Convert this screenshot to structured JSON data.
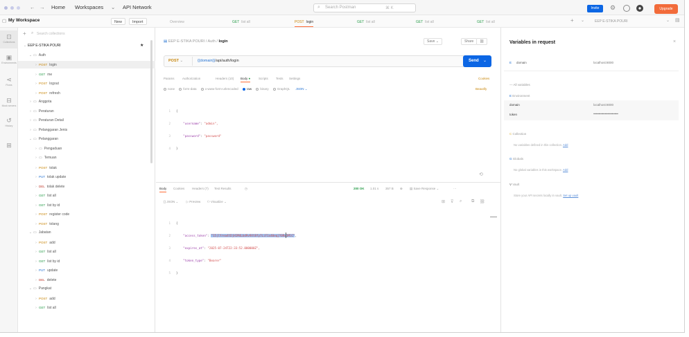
{
  "titlebar": {
    "nav": [
      "Home",
      "Workspaces",
      "API Network"
    ],
    "search_placeholder": "Search Postman",
    "search_shortcut": "⌘ K",
    "invite_label": "Invite",
    "upgrade_label": "Upgrade"
  },
  "workspace": {
    "name": "My Workspace",
    "new_label": "New",
    "import_label": "Import"
  },
  "tabs": [
    {
      "method": "",
      "label": "Overview"
    },
    {
      "method": "GET",
      "label": "list all"
    },
    {
      "method": "POST",
      "label": "login"
    },
    {
      "method": "GET",
      "label": "list all"
    },
    {
      "method": "GET",
      "label": "list all"
    },
    {
      "method": "GET",
      "label": "list all"
    }
  ],
  "env_selector": "EEP E-STIKA POURI",
  "leftnav": [
    {
      "icon": "collections-icon",
      "label": "Collections"
    },
    {
      "icon": "environments-icon",
      "label": "Environments"
    },
    {
      "icon": "flows-icon",
      "label": "Flows"
    },
    {
      "icon": "mock-servers-icon",
      "label": "Mock servers"
    },
    {
      "icon": "history-icon",
      "label": "History"
    },
    {
      "icon": "apps-icon",
      "label": ""
    }
  ],
  "sidebar": {
    "search_placeholder": "Search collections",
    "items": [
      {
        "depth": 0,
        "kind": "collection",
        "method": "",
        "label": "EEP E-STIKA POURI"
      },
      {
        "depth": 1,
        "kind": "folder",
        "method": "",
        "label": "Auth"
      },
      {
        "depth": 2,
        "kind": "request",
        "method": "POST",
        "label": "login"
      },
      {
        "depth": 2,
        "kind": "request",
        "method": "GET",
        "label": "me"
      },
      {
        "depth": 2,
        "kind": "request",
        "method": "POST",
        "label": "logout"
      },
      {
        "depth": 2,
        "kind": "request",
        "method": "POST",
        "label": "refresh"
      },
      {
        "depth": 1,
        "kind": "folder",
        "method": "",
        "label": "Anggota"
      },
      {
        "depth": 1,
        "kind": "folder",
        "method": "",
        "label": "Peraturan"
      },
      {
        "depth": 1,
        "kind": "folder",
        "method": "",
        "label": "Peraturan Detail"
      },
      {
        "depth": 1,
        "kind": "folder",
        "method": "",
        "label": "Pelanggaran Jenis"
      },
      {
        "depth": 1,
        "kind": "folder",
        "method": "",
        "label": "Pelanggaran"
      },
      {
        "depth": 2,
        "kind": "folder",
        "method": "",
        "label": "Pengaduan"
      },
      {
        "depth": 2,
        "kind": "folder",
        "method": "",
        "label": "Temuan"
      },
      {
        "depth": 2,
        "kind": "request",
        "method": "POST",
        "label": "tolak"
      },
      {
        "depth": 2,
        "kind": "request",
        "method": "PUT",
        "label": "tolak update"
      },
      {
        "depth": 2,
        "kind": "request",
        "method": "DEL",
        "label": "tolak delete"
      },
      {
        "depth": 2,
        "kind": "request",
        "method": "GET",
        "label": "list all"
      },
      {
        "depth": 2,
        "kind": "request",
        "method": "GET",
        "label": "list by id"
      },
      {
        "depth": 2,
        "kind": "request",
        "method": "POST",
        "label": "register code"
      },
      {
        "depth": 2,
        "kind": "request",
        "method": "POST",
        "label": "tolang"
      },
      {
        "depth": 1,
        "kind": "folder",
        "method": "",
        "label": "Jabatan"
      },
      {
        "depth": 2,
        "kind": "request",
        "method": "POST",
        "label": "add"
      },
      {
        "depth": 2,
        "kind": "request",
        "method": "GET",
        "label": "list all"
      },
      {
        "depth": 2,
        "kind": "request",
        "method": "GET",
        "label": "list by id"
      },
      {
        "depth": 2,
        "kind": "request",
        "method": "PUT",
        "label": "update"
      },
      {
        "depth": 2,
        "kind": "request",
        "method": "DEL",
        "label": "delete"
      },
      {
        "depth": 1,
        "kind": "folder",
        "method": "",
        "label": "Pangkat"
      },
      {
        "depth": 2,
        "kind": "request",
        "method": "POST",
        "label": "add"
      },
      {
        "depth": 2,
        "kind": "request",
        "method": "GET",
        "label": "list all"
      }
    ]
  },
  "request": {
    "breadcrumb_collection": "EEP E-STIKA POURI",
    "breadcrumb_folder": "Auth",
    "breadcrumb_current": "login",
    "save_label": "Save",
    "share_label": "Share",
    "method": "POST",
    "url_var": "{{domain}}",
    "url_path": "/api/auth/login",
    "send_label": "Send",
    "tabs": [
      "Params",
      "Authorization",
      "Headers (10)",
      "Body",
      "Scripts",
      "Tests",
      "Settings"
    ],
    "active_tab": "Body",
    "cookies_label": "Cookies",
    "body_types": [
      "none",
      "form-data",
      "x-www-form-urlencoded",
      "raw",
      "binary",
      "GraphQL"
    ],
    "selected_body_type": "raw",
    "format": "JSON",
    "beautify_label": "Beautify",
    "body_lines": [
      {
        "n": "1",
        "key": "",
        "value": "",
        "open": "{"
      },
      {
        "n": "2",
        "key": "\"username\"",
        "value": "\"admin\","
      },
      {
        "n": "3",
        "key": "\"password\"",
        "value": "\"password\""
      },
      {
        "n": "4",
        "key": "",
        "value": "",
        "open": "}"
      }
    ]
  },
  "response": {
    "tabs": [
      "Body",
      "Cookies",
      "Headers (7)",
      "Test Results"
    ],
    "status": "200 OK",
    "time": "1.01 s",
    "size": "357 B",
    "save_response": "Save Response",
    "format": "JSON",
    "preview_label": "Preview",
    "visualize_label": "Visualize",
    "lines": [
      {
        "n": "1",
        "key": "",
        "value": "{"
      },
      {
        "n": "2",
        "key": "\"access_token\"",
        "value": "\"15|lYrea4tDjH1M4Lbd9v9Xt8fy7LiF1x40eqjY0Rw3MlC\""
      },
      {
        "n": "3",
        "key": "\"expires_at\"",
        "value": "\"2025-07-24T22:33:52.000000Z\","
      },
      {
        "n": "4",
        "key": "\"token_type\"",
        "value": "\"Bearer\""
      },
      {
        "n": "5",
        "key": "",
        "value": "}"
      }
    ]
  },
  "variables": {
    "title": "Variables in request",
    "request_var": {
      "name": "domain",
      "value": "localhost:8000"
    },
    "all_variables_label": "All variables",
    "environment_label": "Environment",
    "env_vars": [
      {
        "name": "domain",
        "value": "localhost:8000"
      },
      {
        "name": "token",
        "value": "••••••••••••••••••••••••••••"
      }
    ],
    "collection_label": "Collection",
    "collection_note": "No variables defined in this collection.",
    "collection_link": "Add",
    "globals_label": "Globals",
    "globals_note": "No global variables in this workspace.",
    "globals_link": "Add",
    "vault_label": "Vault",
    "vault_note": "Store your API secrets locally in vault.",
    "vault_link": "Set up vault"
  },
  "colors": {
    "accent": "#ff6c37",
    "primary": "#0c66e4",
    "status_ok": "#2a9d4b"
  }
}
